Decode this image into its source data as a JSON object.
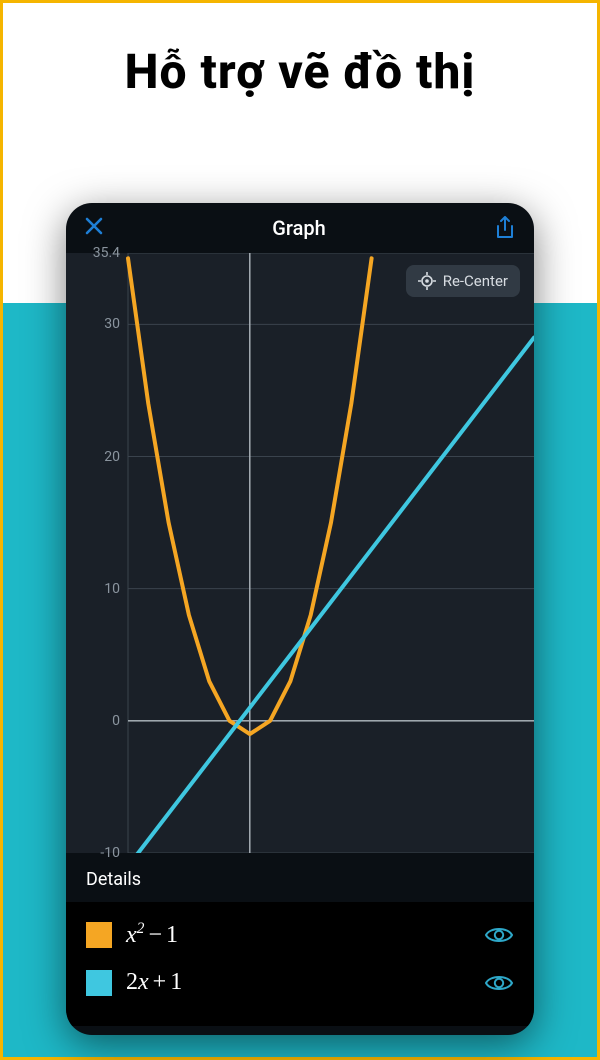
{
  "page": {
    "headline": "Hỗ trợ vẽ đồ thị"
  },
  "app": {
    "title": "Graph",
    "recenter_label": "Re-Center",
    "details_label": "Details"
  },
  "chart_data": {
    "type": "line",
    "title": "Graph",
    "xlabel": "",
    "ylabel": "",
    "xlim": [
      -6,
      14
    ],
    "ylim": [
      -10,
      35.4
    ],
    "yticks": [
      -10,
      0,
      10,
      20,
      30,
      35.4
    ],
    "series": [
      {
        "name": "x^2 - 1",
        "color": "#f5a623",
        "formula_parts": {
          "var": "x",
          "exp": "2",
          "op": "−",
          "c": "1"
        },
        "x": [
          -6,
          -5,
          -4,
          -3,
          -2,
          -1,
          0,
          1,
          2,
          3,
          4,
          5,
          6
        ],
        "y": [
          35,
          24,
          15,
          8,
          3,
          0,
          -1,
          0,
          3,
          8,
          15,
          24,
          35
        ]
      },
      {
        "name": "2x + 1",
        "color": "#3fc7e0",
        "formula_parts": {
          "coef": "2",
          "var": "x",
          "op": "+",
          "c": "1"
        },
        "x": [
          -6,
          14
        ],
        "y": [
          -11,
          29
        ]
      }
    ]
  }
}
